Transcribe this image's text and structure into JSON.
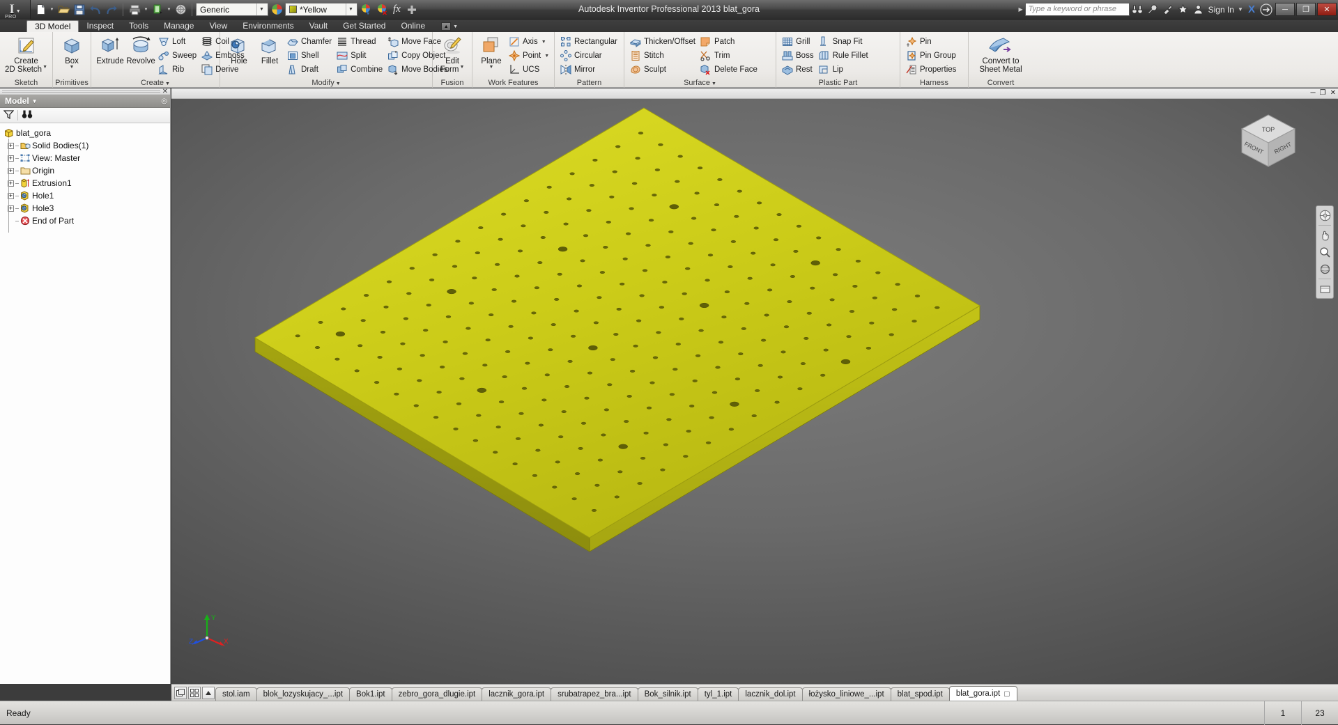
{
  "window": {
    "title": "Autodesk Inventor Professional 2013   blat_gora",
    "app_badge": "PRO",
    "minimize": "─",
    "maximize": "❐",
    "close": "✕"
  },
  "quick_access": {
    "material_combo": "Generic",
    "appearance_combo": "*Yellow",
    "icons": [
      "new-document-icon",
      "open-folder-icon",
      "save-icon",
      "undo-icon",
      "redo-icon",
      "print-icon",
      "update-icon",
      "material-sphere-icon"
    ],
    "fx_label": "fx",
    "customize_label": "+"
  },
  "search": {
    "placeholder": "Type a keyword or phrase",
    "sign_in": "Sign In",
    "icons": [
      "binoculars-icon",
      "wrench-icon",
      "satellite-icon",
      "star-icon",
      "user-icon",
      "exchange-icon"
    ],
    "autodesk_mark": "X"
  },
  "ribbon": {
    "tabs": [
      {
        "label": "3D Model",
        "active": true
      },
      {
        "label": "Inspect",
        "active": false
      },
      {
        "label": "Tools",
        "active": false
      },
      {
        "label": "Manage",
        "active": false
      },
      {
        "label": "View",
        "active": false
      },
      {
        "label": "Environments",
        "active": false
      },
      {
        "label": "Vault",
        "active": false
      },
      {
        "label": "Get Started",
        "active": false
      },
      {
        "label": "Online",
        "active": false
      }
    ],
    "panels": [
      {
        "title": "Sketch",
        "dropdown": false,
        "big": [
          {
            "label": "Create\n2D Sketch",
            "icon": "create-2d-sketch-icon",
            "dd": true
          }
        ],
        "cols": []
      },
      {
        "title": "Primitives",
        "dropdown": false,
        "big": [
          {
            "label": "Box",
            "icon": "box-icon",
            "dd": true
          }
        ],
        "cols": []
      },
      {
        "title": "Create",
        "dropdown": true,
        "big": [
          {
            "label": "Extrude",
            "icon": "extrude-icon",
            "dd": false
          },
          {
            "label": "Revolve",
            "icon": "revolve-icon",
            "dd": false
          }
        ],
        "cols": [
          [
            {
              "label": "Loft",
              "icon": "loft-icon"
            },
            {
              "label": "Sweep",
              "icon": "sweep-icon"
            },
            {
              "label": "Rib",
              "icon": "rib-icon"
            }
          ],
          [
            {
              "label": "Coil",
              "icon": "coil-icon"
            },
            {
              "label": "Emboss",
              "icon": "emboss-icon"
            },
            {
              "label": "Derive",
              "icon": "derive-icon"
            }
          ]
        ]
      },
      {
        "title": "Modify",
        "dropdown": true,
        "big": [
          {
            "label": "Hole",
            "icon": "hole-icon",
            "dd": false
          },
          {
            "label": "Fillet",
            "icon": "fillet-icon",
            "dd": false
          }
        ],
        "cols": [
          [
            {
              "label": "Chamfer",
              "icon": "chamfer-icon"
            },
            {
              "label": "Shell",
              "icon": "shell-icon"
            },
            {
              "label": "Draft",
              "icon": "draft-icon"
            }
          ],
          [
            {
              "label": "Thread",
              "icon": "thread-icon"
            },
            {
              "label": "Split",
              "icon": "split-icon"
            },
            {
              "label": "Combine",
              "icon": "combine-icon"
            }
          ],
          [
            {
              "label": "Move Face",
              "icon": "move-face-icon"
            },
            {
              "label": "Copy Object",
              "icon": "copy-object-icon"
            },
            {
              "label": "Move Bodies",
              "icon": "move-bodies-icon"
            }
          ]
        ]
      },
      {
        "title": "Fusion",
        "dropdown": false,
        "big": [
          {
            "label": "Edit\nForm",
            "icon": "edit-form-icon",
            "dd": true
          }
        ],
        "cols": []
      },
      {
        "title": "Work Features",
        "dropdown": false,
        "big": [
          {
            "label": "Plane",
            "icon": "plane-icon",
            "dd": true
          }
        ],
        "cols": [
          [
            {
              "label": "Axis",
              "icon": "axis-icon",
              "dd": true
            },
            {
              "label": "Point",
              "icon": "point-icon",
              "dd": true
            },
            {
              "label": "UCS",
              "icon": "ucs-icon"
            }
          ]
        ]
      },
      {
        "title": "Pattern",
        "dropdown": false,
        "big": [],
        "cols": [
          [
            {
              "label": "Rectangular",
              "icon": "rectangular-pattern-icon"
            },
            {
              "label": "Circular",
              "icon": "circular-pattern-icon"
            },
            {
              "label": "Mirror",
              "icon": "mirror-icon"
            }
          ]
        ]
      },
      {
        "title": "Surface",
        "dropdown": true,
        "big": [],
        "cols": [
          [
            {
              "label": "Thicken/Offset",
              "icon": "thicken-offset-icon"
            },
            {
              "label": "Stitch",
              "icon": "stitch-icon"
            },
            {
              "label": "Sculpt",
              "icon": "sculpt-icon"
            }
          ],
          [
            {
              "label": "Patch",
              "icon": "patch-icon"
            },
            {
              "label": "Trim",
              "icon": "trim-icon"
            },
            {
              "label": "Delete Face",
              "icon": "delete-face-icon"
            }
          ]
        ]
      },
      {
        "title": "Plastic Part",
        "dropdown": false,
        "big": [],
        "cols": [
          [
            {
              "label": "Grill",
              "icon": "grill-icon"
            },
            {
              "label": "Boss",
              "icon": "boss-icon"
            },
            {
              "label": "Rest",
              "icon": "rest-icon"
            }
          ],
          [
            {
              "label": "Snap Fit",
              "icon": "snap-fit-icon"
            },
            {
              "label": "Rule Fillet",
              "icon": "rule-fillet-icon"
            },
            {
              "label": "Lip",
              "icon": "lip-icon"
            }
          ]
        ]
      },
      {
        "title": "Harness",
        "dropdown": false,
        "big": [],
        "cols": [
          [
            {
              "label": "Pin",
              "icon": "pin-icon"
            },
            {
              "label": "Pin Group",
              "icon": "pin-group-icon"
            },
            {
              "label": "Properties",
              "icon": "properties-icon"
            }
          ]
        ]
      },
      {
        "title": "Convert",
        "dropdown": false,
        "big": [
          {
            "label": "Convert to\nSheet Metal",
            "icon": "convert-sheet-metal-icon",
            "dd": false
          }
        ],
        "cols": []
      }
    ]
  },
  "browser": {
    "header": "Model",
    "filter_icon": "filter-icon",
    "find_icon": "binoculars-icon",
    "tree": [
      {
        "label": "blat_gora",
        "icon": "part-icon",
        "expander": false,
        "depth": 0
      },
      {
        "label": "Solid Bodies(1)",
        "icon": "solid-bodies-icon",
        "expander": true,
        "depth": 1
      },
      {
        "label": "View: Master",
        "icon": "view-master-icon",
        "expander": true,
        "depth": 1
      },
      {
        "label": "Origin",
        "icon": "origin-folder-icon",
        "expander": true,
        "depth": 1
      },
      {
        "label": "Extrusion1",
        "icon": "extrusion-icon",
        "expander": true,
        "depth": 1
      },
      {
        "label": "Hole1",
        "icon": "hole-feature-icon",
        "expander": true,
        "depth": 1
      },
      {
        "label": "Hole3",
        "icon": "hole-feature-icon",
        "expander": true,
        "depth": 1
      },
      {
        "label": "End of Part",
        "icon": "end-of-part-icon",
        "expander": false,
        "depth": 1
      }
    ]
  },
  "viewport": {
    "model_color": "#c9c918",
    "model_side_color": "#8f8f10",
    "background_top": "#787878",
    "background_bottom": "#2e2e2e",
    "viewcube_labels": {
      "top": "TOP",
      "front": "FRONT",
      "right": "RIGHT"
    },
    "triad_labels": {
      "x": "X",
      "y": "Y",
      "z": "Z"
    },
    "nav_icons": [
      "full-navigation-wheel-icon",
      "pan-icon",
      "zoom-icon",
      "orbit-icon",
      "look-at-icon"
    ],
    "window_controls": {
      "minimize": "─",
      "restore": "❐",
      "close": "✕"
    }
  },
  "document_tabs": {
    "left_buttons": [
      "tile-windows-icon",
      "arrange-icons-icon",
      "scroll-up-icon"
    ],
    "items": [
      {
        "label": "stol.iam",
        "active": false
      },
      {
        "label": "blok_lozyskujacy_...ipt",
        "active": false
      },
      {
        "label": "Bok1.ipt",
        "active": false
      },
      {
        "label": "zebro_gora_dlugie.ipt",
        "active": false
      },
      {
        "label": "lacznik_gora.ipt",
        "active": false
      },
      {
        "label": "srubatrapez_bra...ipt",
        "active": false
      },
      {
        "label": "Bok_silnik.ipt",
        "active": false
      },
      {
        "label": "tyl_1.ipt",
        "active": false
      },
      {
        "label": "lacznik_dol.ipt",
        "active": false
      },
      {
        "label": "łożysko_liniowe_...ipt",
        "active": false
      },
      {
        "label": "blat_spod.ipt",
        "active": false
      },
      {
        "label": "blat_gora.ipt",
        "active": true
      }
    ]
  },
  "status_bar": {
    "message": "Ready",
    "field1": "1",
    "field2": "23"
  }
}
